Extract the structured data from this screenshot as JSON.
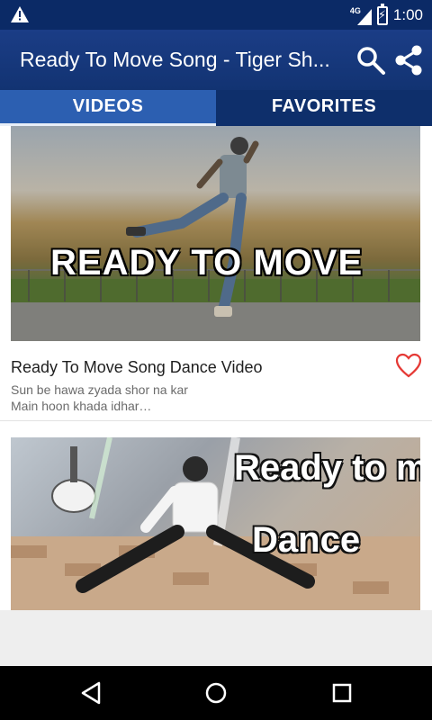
{
  "status_bar": {
    "network": "4G",
    "time": "1:00",
    "icons": [
      "warning-icon",
      "signal-icon",
      "battery-charging-icon"
    ]
  },
  "app_bar": {
    "title": "Ready To Move Song - Tiger Sh...",
    "icons": [
      "search-icon",
      "share-icon"
    ]
  },
  "tabs": [
    {
      "label": "VIDEOS",
      "selected": true
    },
    {
      "label": "FAVORITES",
      "selected": false
    }
  ],
  "videos": [
    {
      "thumbnail_text": "READY TO MOVE",
      "title": "Ready To Move Song Dance Video",
      "description_line1": "Sun be hawa zyada shor na kar",
      "description_line2": "Main hoon khada idhar…",
      "favorite_icon": "heart-outline-icon"
    },
    {
      "thumbnail_text_line1": "Ready to mOve",
      "thumbnail_text_line2": "Dance"
    }
  ],
  "nav_bar": {
    "icons": [
      "back-icon",
      "home-icon",
      "recents-icon"
    ]
  },
  "colors": {
    "app_bar": "#1b3d86",
    "tab_selected": "#2c5fb1",
    "tab_unselected": "#0e2f6b",
    "favorite_heart": "#e53935"
  }
}
